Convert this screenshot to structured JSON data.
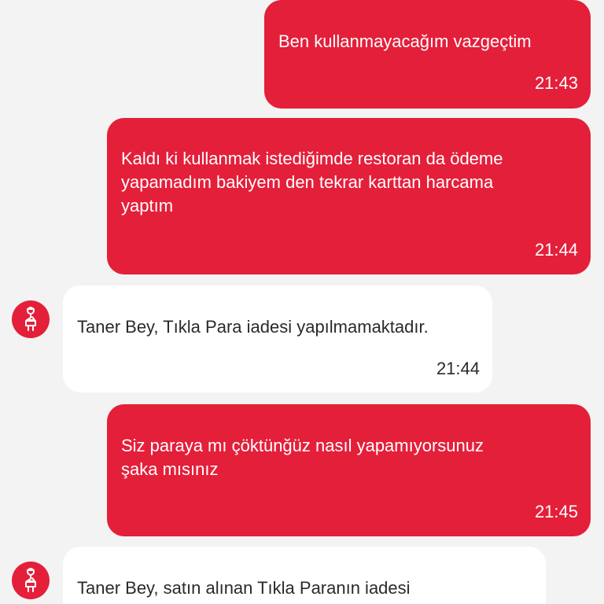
{
  "messages": [
    {
      "direction": "outgoing",
      "text": "Ben kullanmayacağım vazgeçtim",
      "time": "21:43"
    },
    {
      "direction": "outgoing",
      "text": "Kaldı ki kullanmak istediğimde restoran da ödeme\nyapamadım bakiyem den tekrar karttan harcama\nyaptım",
      "time": "21:44"
    },
    {
      "direction": "incoming",
      "text": "Taner Bey, Tıkla Para iadesi yapılmamaktadır.",
      "time": "21:44",
      "avatar_icon": "courier-scooter-icon"
    },
    {
      "direction": "outgoing",
      "text": "Siz paraya mı çöktünğüz nasıl yapamıyorsunuz\nşaka mısınız",
      "time": "21:45"
    },
    {
      "direction": "incoming",
      "text": "Taner Bey, satın alınan Tıkla Paranın iadesi",
      "avatar_icon": "courier-scooter-icon"
    }
  ],
  "colors": {
    "outgoing_bubble": "#e41f3a",
    "incoming_bubble": "#ffffff",
    "background": "#f3f3f3"
  }
}
